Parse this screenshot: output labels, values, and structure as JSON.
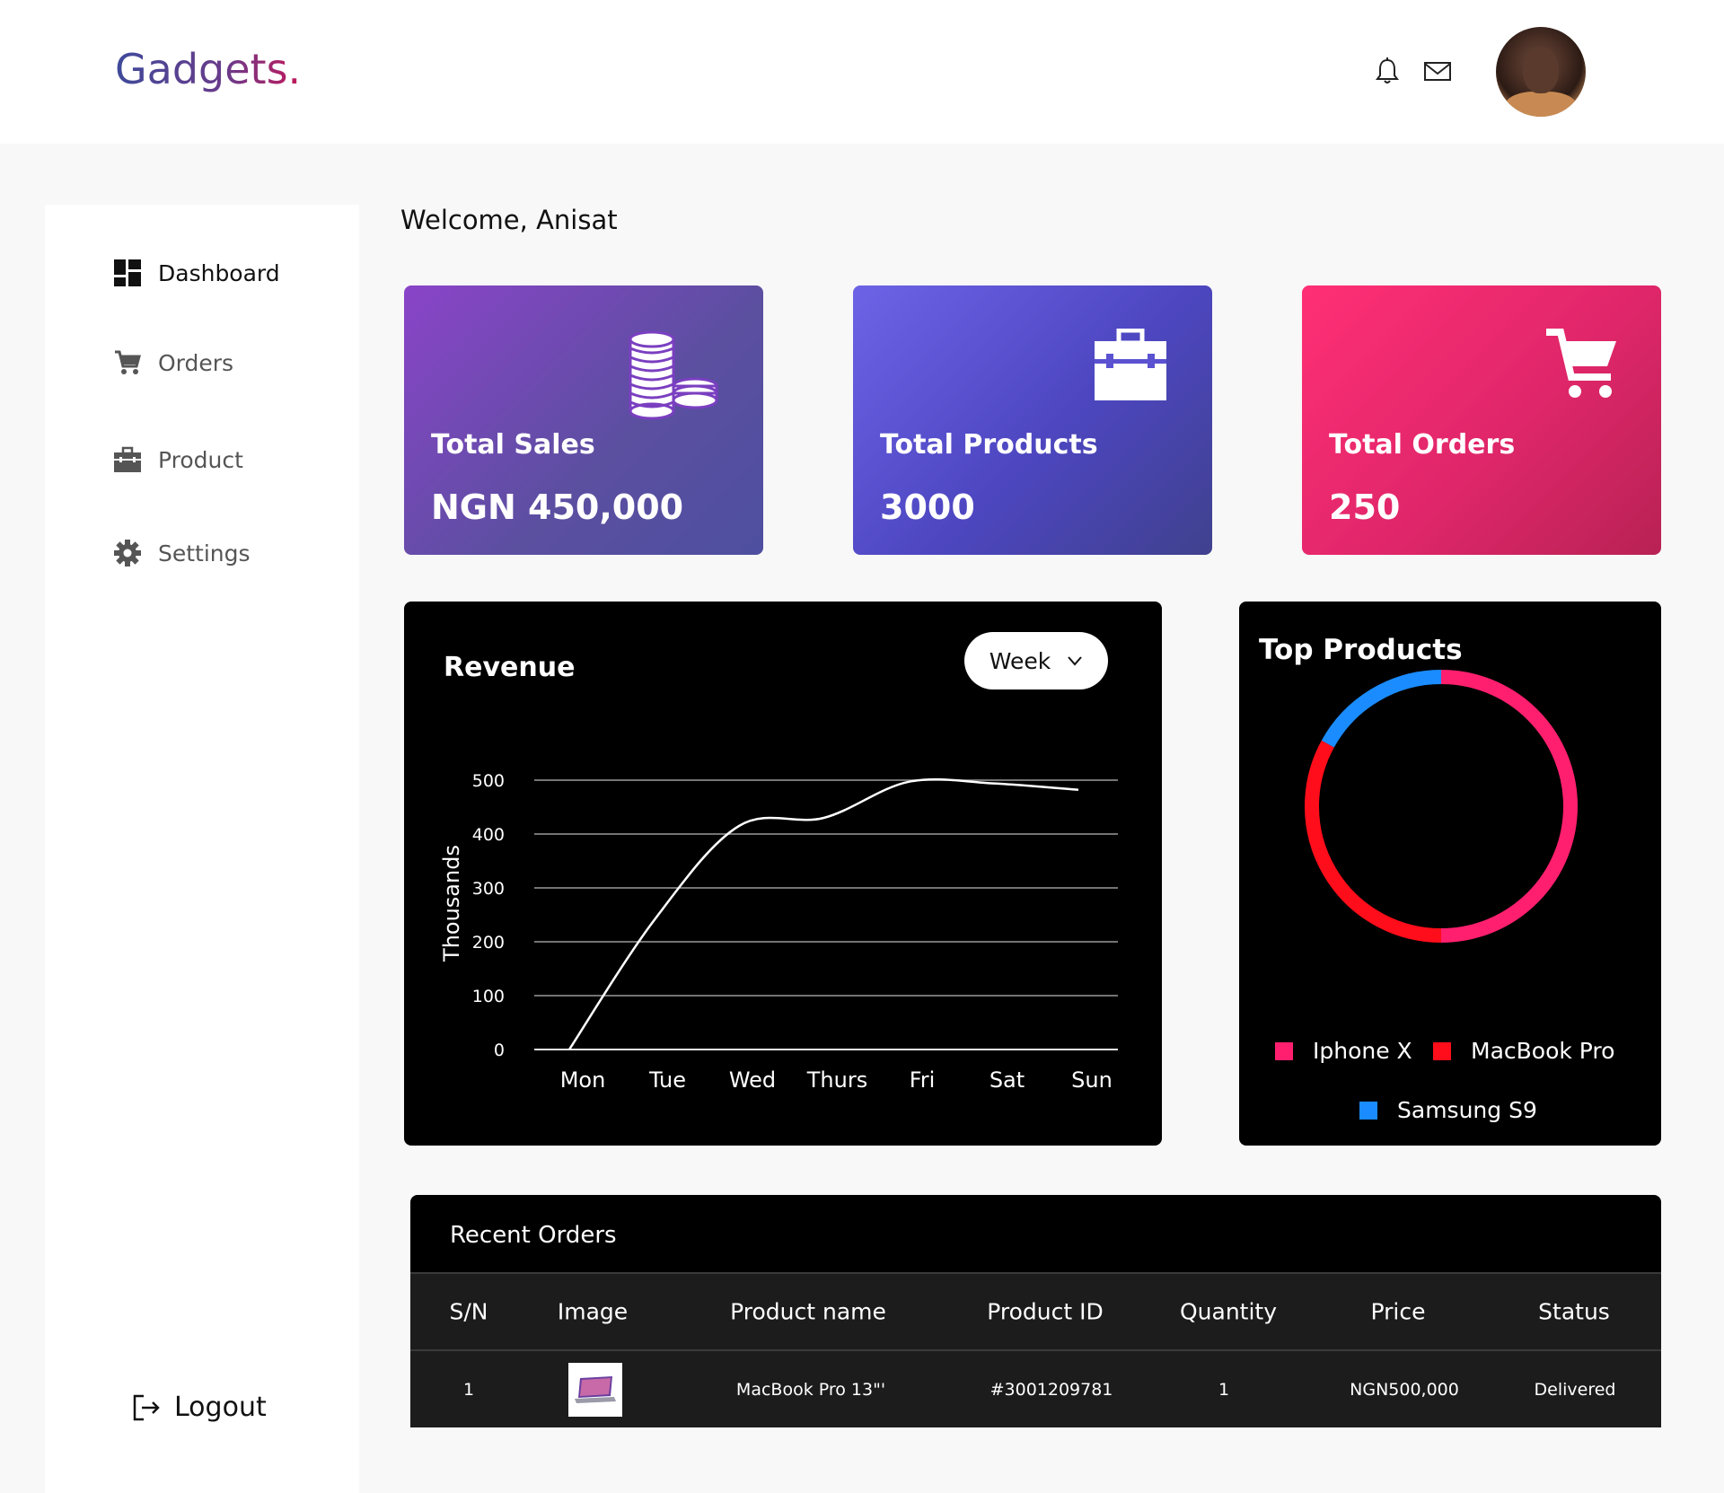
{
  "app": {
    "logo": "Gadgets."
  },
  "header": {
    "icons": [
      "bell-icon",
      "mail-icon"
    ],
    "avatar": "user-avatar"
  },
  "sidebar": {
    "items": [
      {
        "label": "Dashboard",
        "icon": "dashboard-icon",
        "active": true
      },
      {
        "label": "Orders",
        "icon": "cart-icon",
        "active": false
      },
      {
        "label": "Product",
        "icon": "briefcase-icon",
        "active": false
      },
      {
        "label": "Settings",
        "icon": "gear-icon",
        "active": false
      }
    ],
    "logout": "Logout"
  },
  "main": {
    "welcome": "Welcome, Anisat",
    "cards": [
      {
        "label": "Total Sales",
        "value": "NGN 450,000",
        "icon": "coins-icon"
      },
      {
        "label": "Total Products",
        "value": "3000",
        "icon": "briefcase-icon"
      },
      {
        "label": "Total Orders",
        "value": "250",
        "icon": "cart-icon"
      }
    ]
  },
  "revenue": {
    "title": "Revenue",
    "period": "Week"
  },
  "top_products": {
    "title": "Top Products"
  },
  "recent_orders": {
    "title": "Recent Orders",
    "columns": [
      "S/N",
      "Image",
      "Product name",
      "Product ID",
      "Quantity",
      "Price",
      "Status"
    ],
    "rows": [
      {
        "sn": "1",
        "image": "macbook-thumbnail",
        "name": "MacBook Pro 13\"'",
        "id": "#3001209781",
        "quantity": "1",
        "price": "NGN500,000",
        "status": "Delivered"
      }
    ]
  },
  "colors": {
    "accent_purple": "#5b4fa0",
    "accent_blue": "#4d46c0",
    "accent_pink": "#ff2f75",
    "iphone": "#ff1f6e",
    "macbook": "#ff0d1a",
    "samsung": "#1a8cff"
  },
  "chart_data": [
    {
      "type": "line",
      "title": "Revenue",
      "ylabel": "Thousands",
      "xlabel": "",
      "categories": [
        "Mon",
        "Tue",
        "Wed",
        "Thurs",
        "Fri",
        "Sat",
        "Sun"
      ],
      "series": [
        {
          "values": [
            0,
            240,
            415,
            430,
            497,
            494,
            482
          ]
        }
      ],
      "ylim": [
        0,
        500
      ],
      "yticks": [
        "0",
        "100",
        "200",
        "300",
        "400",
        "500"
      ],
      "grid": true
    },
    {
      "type": "pie",
      "title": "Top Products",
      "labels": [
        "Iphone X",
        "MacBook Pro",
        "Samsung S9"
      ],
      "values": [
        50,
        33,
        17
      ],
      "donut": true,
      "legend": "bottom"
    }
  ]
}
